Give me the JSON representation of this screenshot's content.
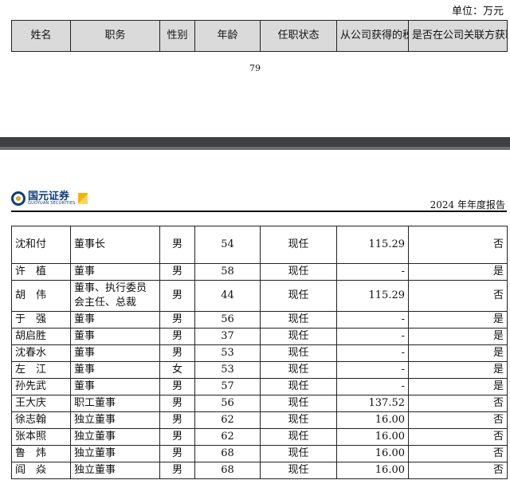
{
  "unit_label": "单位：万元",
  "header": [
    "姓名",
    "职务",
    "性别",
    "年龄",
    "任职状态",
    "从公司获得的税前报酬总额",
    "是否在公司关联方获取报酬"
  ],
  "page_number": "79",
  "logo": {
    "cn": "国元证券",
    "en": "GUOYUAN SECURITIES"
  },
  "report_title": "2024 年年度报告",
  "rows": [
    {
      "name": "沈和付",
      "position": "董事长",
      "gender": "男",
      "age": "54",
      "status": "现任",
      "pay": "115.29",
      "related": "否"
    },
    {
      "name": "许　植",
      "position": "董事",
      "gender": "男",
      "age": "58",
      "status": "现任",
      "pay": "-",
      "related": "是"
    },
    {
      "name": "胡　伟",
      "position": "董事、执行委员会主任、总裁",
      "gender": "男",
      "age": "44",
      "status": "现任",
      "pay": "115.29",
      "related": "否"
    },
    {
      "name": "于　强",
      "position": "董事",
      "gender": "男",
      "age": "56",
      "status": "现任",
      "pay": "-",
      "related": "是"
    },
    {
      "name": "胡启胜",
      "position": "董事",
      "gender": "男",
      "age": "37",
      "status": "现任",
      "pay": "-",
      "related": "是"
    },
    {
      "name": "沈春水",
      "position": "董事",
      "gender": "男",
      "age": "53",
      "status": "现任",
      "pay": "-",
      "related": "是"
    },
    {
      "name": "左　江",
      "position": "董事",
      "gender": "女",
      "age": "53",
      "status": "现任",
      "pay": "-",
      "related": "是"
    },
    {
      "name": "孙先武",
      "position": "董事",
      "gender": "男",
      "age": "57",
      "status": "现任",
      "pay": "-",
      "related": "是"
    },
    {
      "name": "王大庆",
      "position": "职工董事",
      "gender": "男",
      "age": "56",
      "status": "现任",
      "pay": "137.52",
      "related": "否"
    },
    {
      "name": "徐志翰",
      "position": "独立董事",
      "gender": "男",
      "age": "62",
      "status": "现任",
      "pay": "16.00",
      "related": "否"
    },
    {
      "name": "张本照",
      "position": "独立董事",
      "gender": "男",
      "age": "62",
      "status": "现任",
      "pay": "16.00",
      "related": "否"
    },
    {
      "name": "鲁　炜",
      "position": "独立董事",
      "gender": "男",
      "age": "68",
      "status": "现任",
      "pay": "16.00",
      "related": "否"
    },
    {
      "name": "阎　焱",
      "position": "独立董事",
      "gender": "男",
      "age": "68",
      "status": "现任",
      "pay": "16.00",
      "related": "否"
    }
  ]
}
